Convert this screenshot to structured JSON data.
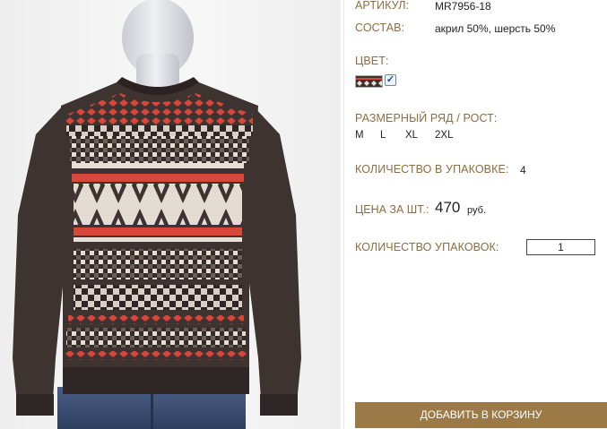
{
  "product": {
    "article_label": "АРТИКУЛ:",
    "article_value": "MR7956-18",
    "composition_label": "СОСТАВ:",
    "composition_value": "акрил 50%, шерсть 50%",
    "color_label": "ЦВЕТ:",
    "color_selected": true,
    "sizes_label": "РАЗМЕРНЫЙ РЯД / РОСТ:",
    "sizes": [
      "M",
      "L",
      "XL",
      "2XL"
    ],
    "pack_qty_label": "КОЛИЧЕСТВО В УПАКОВКЕ:",
    "pack_qty_value": "4",
    "price_label": "ЦЕНА ЗА ШТ.:",
    "price_value": "470",
    "price_unit": "руб.",
    "packs_label": "КОЛИЧЕСТВО УПАКОВОК:",
    "packs_value": "1",
    "add_to_cart_label": "ДОБАВИТЬ В КОРЗИНУ"
  },
  "colors": {
    "label": "#8b6d3f",
    "button": "#9c7a47",
    "sweater_body": "#3d3330",
    "sweater_red": "#d9473a",
    "sweater_cream": "#e8e0d6"
  }
}
